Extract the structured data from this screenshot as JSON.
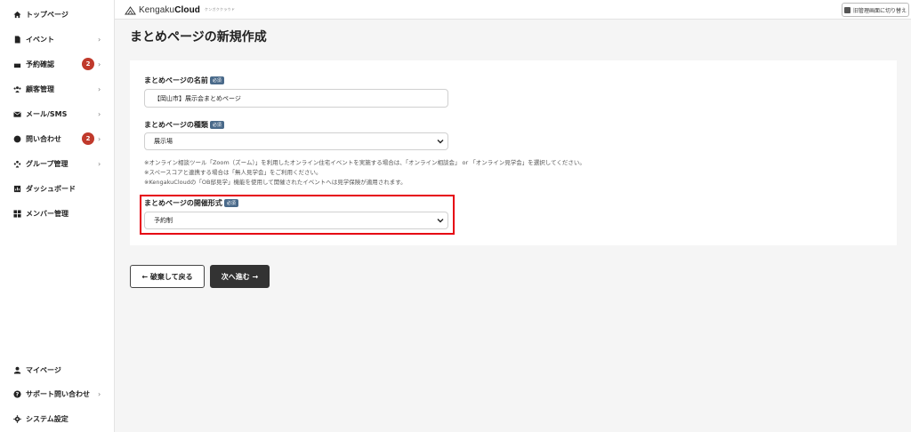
{
  "sidebar": {
    "items": [
      {
        "label": "トップページ",
        "icon": "home-icon",
        "chevron": ""
      },
      {
        "label": "イベント",
        "icon": "document-icon",
        "chevron": "›"
      },
      {
        "label": "予約確認",
        "icon": "calendar-icon",
        "chevron": "›",
        "badge": "2"
      },
      {
        "label": "顧客管理",
        "icon": "people-icon",
        "chevron": "›"
      },
      {
        "label": "メール/SMS",
        "icon": "mail-icon",
        "chevron": "›"
      },
      {
        "label": "問い合わせ",
        "icon": "chat-icon",
        "chevron": "›",
        "badge": "2"
      },
      {
        "label": "グループ管理",
        "icon": "group-icon",
        "chevron": "›"
      },
      {
        "label": "ダッシュボード",
        "icon": "dashboard-icon",
        "chevron": ""
      },
      {
        "label": "メンバー管理",
        "icon": "grid-icon",
        "chevron": ""
      }
    ],
    "bottom_items": [
      {
        "label": "マイページ",
        "icon": "user-icon",
        "chevron": ""
      },
      {
        "label": "サポート問い合わせ",
        "icon": "help-icon",
        "chevron": "›"
      },
      {
        "label": "システム設定",
        "icon": "gear-icon",
        "chevron": ""
      }
    ]
  },
  "header": {
    "logo_text": "Kengaku",
    "logo_bold": "Cloud",
    "logo_sub": "ケンガククラウド",
    "switch_label": "旧管理画面に切り替え"
  },
  "page_title": "まとめページの新規作成",
  "form": {
    "name_label": "まとめページの名前",
    "required_label": "必須",
    "name_value": "【岡山市】展示会まとめページ",
    "type_label": "まとめページの種類",
    "type_value": "展示場",
    "notes": [
      "※オンライン相談ツール「Zoom（ズーム）」を利用したオンライン住宅イベントを実施する場合は、「オンライン相談会」 or 「オンライン見学会」を選択してください。",
      "※スペースコアと連携する場合は「無人見学会」をご利用ください。",
      "※KengakuCloudの「OB邸見学」機能を使用して開催されたイベントへは見学保険が適用されます。"
    ],
    "format_label": "まとめページの開催形式",
    "format_value": "予約制"
  },
  "buttons": {
    "back_label": "← 破棄して戻る",
    "next_label": "次へ進む →"
  },
  "colors": {
    "badge": "#c0392b",
    "highlight": "#e60012",
    "required": "#4a6a8a",
    "primary_button": "#333333"
  }
}
